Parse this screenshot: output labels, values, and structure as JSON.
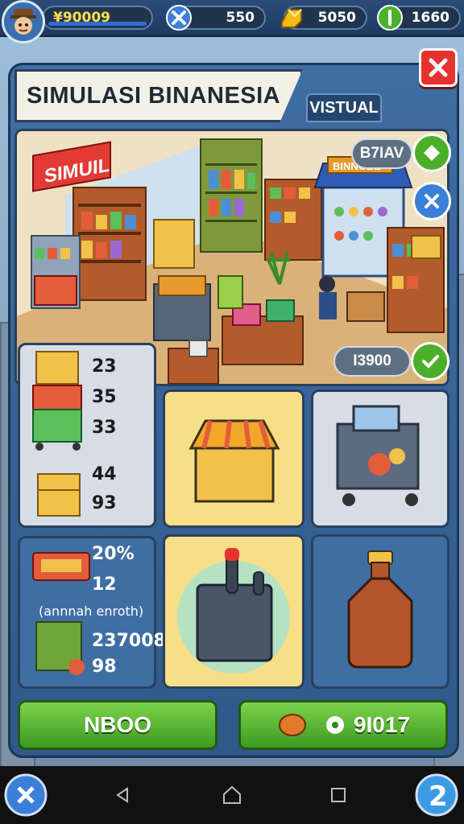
{
  "hud": {
    "money": "¥90009",
    "tools": "550",
    "gold": "5050",
    "energy": "1660"
  },
  "panel": {
    "title": "SIMULASI BINANESIA",
    "tab": "VISTUAL"
  },
  "scene": {
    "shop_sign": "SIMUIL",
    "stall_sign": "BINNOBE",
    "badge_top": "B7IAV",
    "badge_bottom": "I3900"
  },
  "stats": {
    "s1": "23",
    "s2": "35",
    "s3": "33",
    "s4": "44",
    "s5": "93",
    "s6": "20%",
    "s7": "12",
    "note": "(annnah enroth)",
    "s8": "237008",
    "s9": "98"
  },
  "buttons": {
    "left": "NBOO",
    "right": "9I017"
  },
  "colors": {
    "accent_green": "#4caf2a",
    "accent_red": "#e6322f",
    "panel_blue": "#2f5989",
    "card_yellow": "#f6df86"
  }
}
